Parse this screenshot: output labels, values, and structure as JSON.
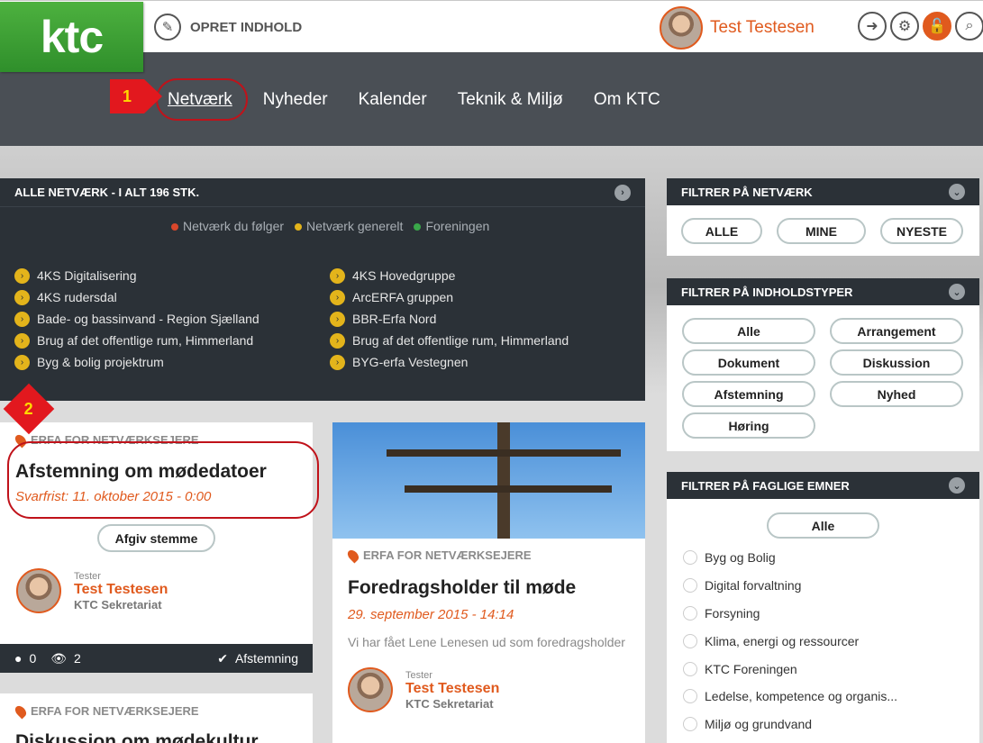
{
  "header": {
    "logo": "ktc",
    "create_label": "OPRET INDHOLD",
    "user_name": "Test Testesen"
  },
  "nav": {
    "items": [
      "Netværk",
      "Nyheder",
      "Kalender",
      "Teknik & Miljø",
      "Om KTC"
    ]
  },
  "markers": {
    "m1": "1",
    "m2": "2"
  },
  "networks": {
    "title": "ALLE NETVÆRK - I ALT 196 STK.",
    "legend": [
      {
        "label": "Netværk du følger",
        "color": "#d9472b"
      },
      {
        "label": "Netværk generelt",
        "color": "#e3b41b"
      },
      {
        "label": "Foreningen",
        "color": "#3aa84a"
      }
    ],
    "col1": [
      "4KS Digitalisering",
      "4KS rudersdal",
      "Bade- og bassinvand - Region Sjælland",
      "Brug af det offentlige rum, Himmerland",
      "Byg & bolig projektrum"
    ],
    "col2": [
      "4KS Hovedgruppe",
      "ArcERFA gruppen",
      "BBR-Erfa Nord",
      "Brug af det offentlige rum, Himmerland",
      "BYG-erfa Vestegnen"
    ]
  },
  "card1": {
    "category": "ERFA FOR NETVÆRKSEJERE",
    "title": "Afstemning om mødedatoer",
    "date": "Svarfrist: 11. oktober 2015 - 0:00",
    "button": "Afgiv stemme",
    "role": "Tester",
    "author": "Test Testesen",
    "org": "KTC Sekretariat",
    "comments": "0",
    "views": "2",
    "type": "Afstemning"
  },
  "card2": {
    "category": "ERFA FOR NETVÆRKSEJERE",
    "title": "Foredragsholder til møde",
    "date": "29. september 2015 - 14:14",
    "excerpt": "Vi har fået Lene Lenesen ud som foredragsholder",
    "role": "Tester",
    "author": "Test Testesen",
    "org": "KTC Sekretariat"
  },
  "card3": {
    "category": "ERFA FOR NETVÆRKSEJERE",
    "title": "Diskussion om mødekultur"
  },
  "filter_net": {
    "title": "FILTRER PÅ NETVÆRK",
    "buttons": [
      "ALLE",
      "MINE",
      "NYESTE"
    ]
  },
  "filter_types": {
    "title": "FILTRER PÅ INDHOLDSTYPER",
    "buttons": [
      "Alle",
      "Arrangement",
      "Dokument",
      "Diskussion",
      "Afstemning",
      "Nyhed",
      "Høring"
    ]
  },
  "filter_topics": {
    "title": "FILTRER PÅ FAGLIGE EMNER",
    "all": "Alle",
    "items": [
      "Byg og Bolig",
      "Digital forvaltning",
      "Forsyning",
      "Klima, energi og ressourcer",
      "KTC Foreningen",
      "Ledelse, kompetence og organis...",
      "Miljø og grundvand"
    ]
  }
}
